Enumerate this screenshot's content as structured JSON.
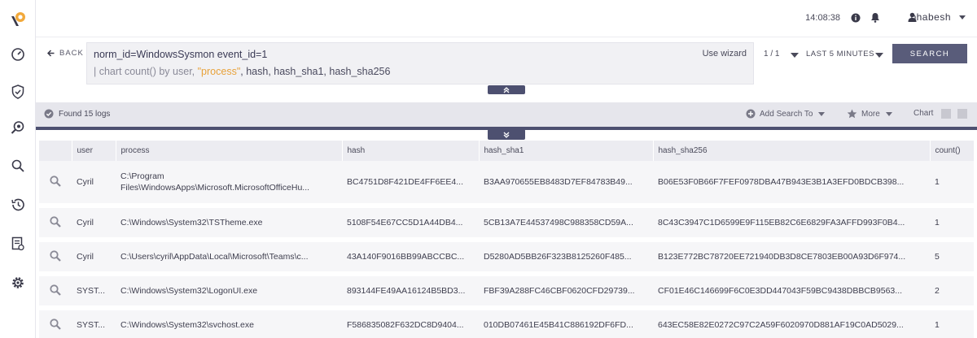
{
  "header": {
    "time": "14:08:38",
    "username": "bhabesh"
  },
  "query": {
    "back_label": "BACK",
    "line1": "norm_id=WindowsSysmon event_id=1",
    "line2_prefix": "| chart count() by user, ",
    "line2_quoted": "\"process\"",
    "line2_suffix": ", hash, hash_sha1, hash_sha256",
    "use_wizard": "Use wizard",
    "pager": "1 / 1",
    "time_range": "LAST 5 MINUTES",
    "search_label": "SEARCH"
  },
  "results": {
    "found": "Found 15 logs",
    "add_search_to": "Add Search To",
    "more": "More",
    "chart": "Chart"
  },
  "table": {
    "columns": [
      "user",
      "process",
      "hash",
      "hash_sha1",
      "hash_sha256",
      "count()"
    ],
    "rows": [
      {
        "user": "Cyril",
        "process": "C:\\Program Files\\WindowsApps\\Microsoft.MicrosoftOfficeHu...",
        "hash": "BC4751D8F421DE4FF6EE4...",
        "hash_sha1": "B3AA970655EB8483D7EF84783B49...",
        "hash_sha256": "B06E53F0B66F7FEF0978DBA47B943E3B1A3EFD0BDCB398...",
        "count": "1"
      },
      {
        "user": "Cyril",
        "process": "C:\\Windows\\System32\\TSTheme.exe",
        "hash": "5108F54E67CC5D1A44DB4...",
        "hash_sha1": "5CB13A7E44537498C988358CD59A...",
        "hash_sha256": "8C43C3947C1D6599E9F115EB82C6E6829FA3AFFD993F0B4...",
        "count": "1"
      },
      {
        "user": "Cyril",
        "process": "C:\\Users\\cyril\\AppData\\Local\\Microsoft\\Teams\\c...",
        "hash": "43A140F9016BB99ABCCBC...",
        "hash_sha1": "D5280AD5BB26F323B8125260F485...",
        "hash_sha256": "B123E772BC78720EE721940DB3D8CE7803EB00A93D6F974...",
        "count": "5"
      },
      {
        "user": "SYST...",
        "process": "C:\\Windows\\System32\\LogonUI.exe",
        "hash": "893144FE49AA16124B5BD3...",
        "hash_sha1": "FBF39A288FC46CBF0620CFD29739...",
        "hash_sha256": "CF01E46C146699F6C0E3DD447043F59BC9438DBBCB9563...",
        "count": "2"
      },
      {
        "user": "SYST...",
        "process": "C:\\Windows\\System32\\svchost.exe",
        "hash": "F586835082F632DC8D9404...",
        "hash_sha1": "010DB07461E45B41C886192DF6FD...",
        "hash_sha256": "643EC58E82E0272C97C2A59F6020970D881AF19C0AD5029...",
        "count": "1"
      }
    ]
  },
  "colors": {
    "accent": "#595c7a",
    "bar": "#4d5070",
    "logo_orange": "#f2a93b"
  },
  "icons": {
    "sidebar": [
      "dashboard-icon",
      "shield-check-icon",
      "search-magnify-icon",
      "search-icon",
      "history-icon",
      "report-icon",
      "settings-icon"
    ]
  }
}
